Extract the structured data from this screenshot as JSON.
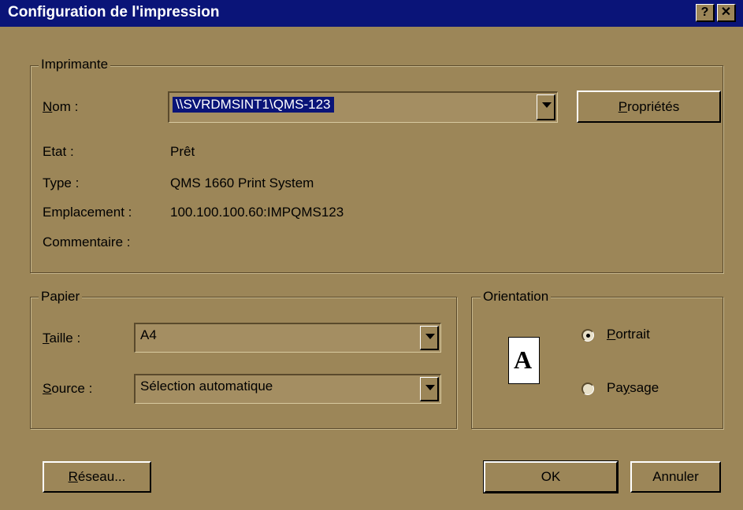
{
  "window": {
    "title": "Configuration de l'impression",
    "help_glyph": "?",
    "close_glyph": "✕"
  },
  "printer": {
    "group_label": "Imprimante",
    "name_label": "Nom :",
    "name_value": "\\\\SVRDMSINT1\\QMS-123",
    "properties_button": "Propriétés",
    "status_label": "Etat :",
    "status_value": "Prêt",
    "type_label": "Type :",
    "type_value": "QMS 1660 Print System",
    "location_label": "Emplacement :",
    "location_value": "100.100.100.60:IMPQMS123",
    "comment_label": "Commentaire :"
  },
  "paper": {
    "group_label": "Papier",
    "size_label": "Taille :",
    "size_value": "A4",
    "source_label": "Source :",
    "source_value": "Sélection automatique"
  },
  "orientation": {
    "group_label": "Orientation",
    "page_glyph": "A",
    "portrait_label": "Portrait",
    "landscape_label": "Paysage",
    "selected": "Portrait"
  },
  "buttons": {
    "network": "Réseau...",
    "ok": "OK",
    "cancel": "Annuler"
  },
  "colors": {
    "face": "#9c8658",
    "title_bar": "#0a1478",
    "selection": "#0a1478"
  }
}
